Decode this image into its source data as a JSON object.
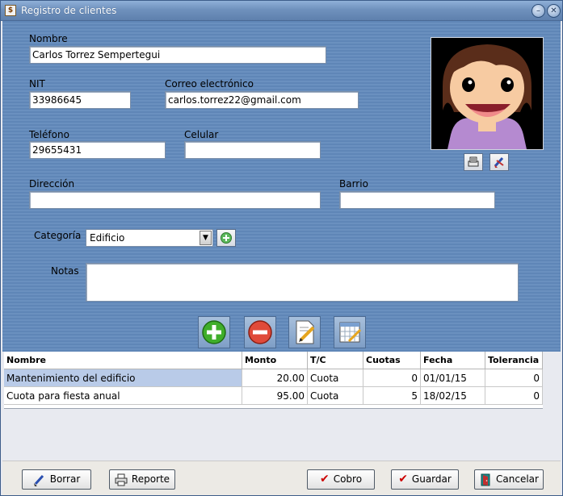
{
  "window": {
    "title": "Registro de clientes",
    "icon_glyph": "$"
  },
  "labels": {
    "nombre": "Nombre",
    "nit": "NIT",
    "correo": "Correo electrónico",
    "telefono": "Teléfono",
    "celular": "Celular",
    "direccion": "Dirección",
    "barrio": "Barrio",
    "categoria": "Categoría",
    "notas": "Notas"
  },
  "fields": {
    "nombre": "Carlos Torrez Sempertegui",
    "nit": "33986645",
    "correo": "carlos.torrez22@gmail.com",
    "telefono": "29655431",
    "celular": "",
    "direccion": "",
    "barrio": "",
    "categoria": "Edificio",
    "notas": ""
  },
  "grid": {
    "columns": [
      "Nombre",
      "Monto",
      "T/C",
      "Cuotas",
      "Fecha",
      "Tolerancia"
    ],
    "rows": [
      [
        "Mantenimiento del edificio",
        "20.00",
        "Cuota",
        "0",
        "01/01/15",
        "0"
      ],
      [
        "Cuota para fiesta anual",
        "95.00",
        "Cuota",
        "5",
        "18/02/15",
        "0"
      ]
    ]
  },
  "buttons": {
    "borrar": "Borrar",
    "reporte": "Reporte",
    "cobro": "Cobro",
    "guardar": "Guardar",
    "cancelar": "Cancelar"
  },
  "colors": {
    "form_bg": "#6a90bf",
    "selected_row": "#b9cbe8",
    "check": "#cc0000"
  }
}
